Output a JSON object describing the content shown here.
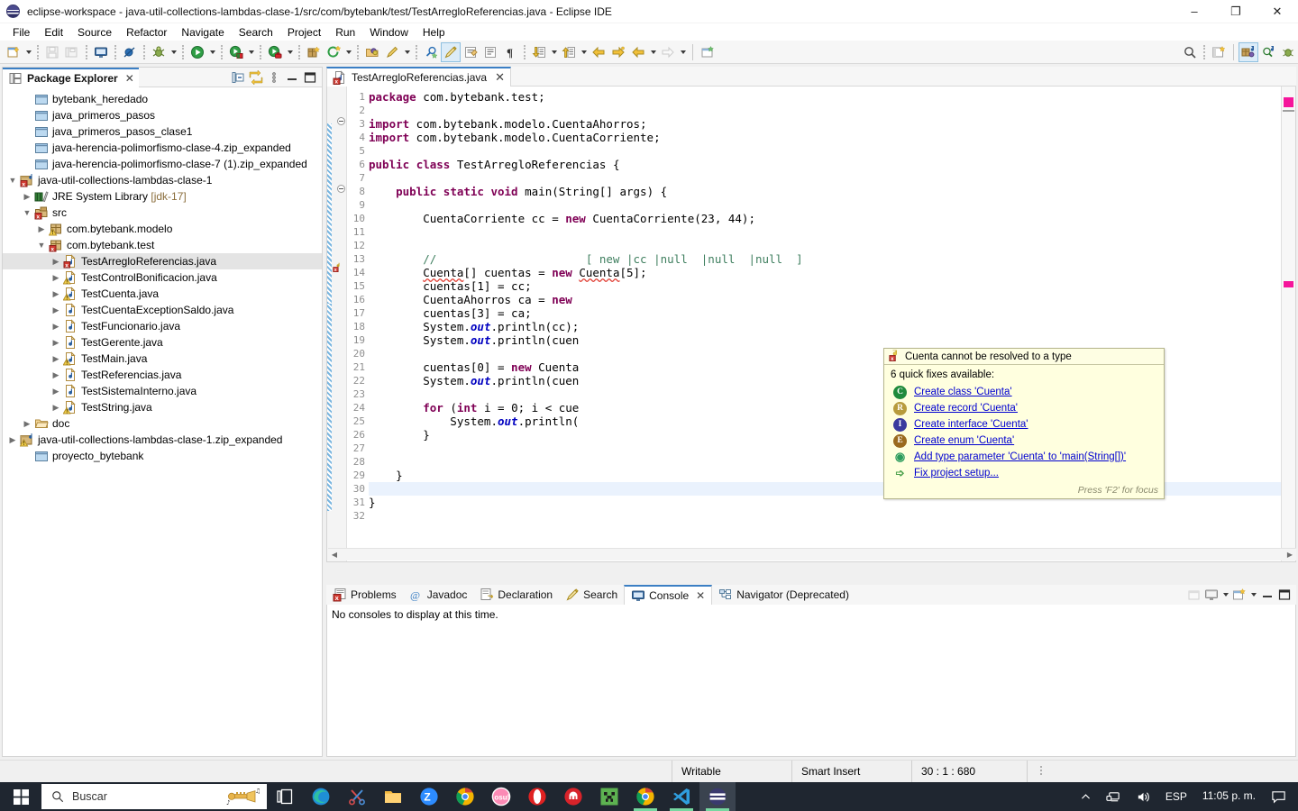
{
  "window": {
    "title": "eclipse-workspace - java-util-collections-lambdas-clase-1/src/com/bytebank/test/TestArregloReferencias.java - Eclipse IDE",
    "minimize": "–",
    "maximize": "❐",
    "close": "✕"
  },
  "menu": [
    "File",
    "Edit",
    "Source",
    "Refactor",
    "Navigate",
    "Search",
    "Project",
    "Run",
    "Window",
    "Help"
  ],
  "package_explorer": {
    "tab_label": "Package Explorer",
    "close": "✕",
    "tree": [
      {
        "label": "bytebank_heredado",
        "indent": 1,
        "twist": "",
        "icon": "project-closed-icon"
      },
      {
        "label": "java_primeros_pasos",
        "indent": 1,
        "twist": "",
        "icon": "project-closed-icon"
      },
      {
        "label": "java_primeros_pasos_clase1",
        "indent": 1,
        "twist": "",
        "icon": "project-closed-icon"
      },
      {
        "label": "java-herencia-polimorfismo-clase-4.zip_expanded",
        "indent": 1,
        "twist": "",
        "icon": "project-closed-icon"
      },
      {
        "label": "java-herencia-polimorfismo-clase-7 (1).zip_expanded",
        "indent": 1,
        "twist": "",
        "icon": "project-closed-icon"
      },
      {
        "label": "java-util-collections-lambdas-clase-1",
        "indent": 0,
        "twist": "open",
        "icon": "java-project-error-icon"
      },
      {
        "label": "JRE System Library",
        "suffix": " [jdk-17]",
        "indent": 1,
        "twist": "closed",
        "icon": "library-icon"
      },
      {
        "label": "src",
        "indent": 1,
        "twist": "open",
        "icon": "source-folder-error-icon"
      },
      {
        "label": "com.bytebank.modelo",
        "indent": 2,
        "twist": "closed",
        "icon": "package-warning-icon"
      },
      {
        "label": "com.bytebank.test",
        "indent": 2,
        "twist": "open",
        "icon": "package-error-icon"
      },
      {
        "label": "TestArregloReferencias.java",
        "indent": 3,
        "twist": "closed",
        "icon": "java-file-error-icon",
        "selected": true
      },
      {
        "label": "TestControlBonificacion.java",
        "indent": 3,
        "twist": "closed",
        "icon": "java-file-warning-icon"
      },
      {
        "label": "TestCuenta.java",
        "indent": 3,
        "twist": "closed",
        "icon": "java-file-warning-icon"
      },
      {
        "label": "TestCuentaExceptionSaldo.java",
        "indent": 3,
        "twist": "closed",
        "icon": "java-file-icon"
      },
      {
        "label": "TestFuncionario.java",
        "indent": 3,
        "twist": "closed",
        "icon": "java-file-icon"
      },
      {
        "label": "TestGerente.java",
        "indent": 3,
        "twist": "closed",
        "icon": "java-file-icon"
      },
      {
        "label": "TestMain.java",
        "indent": 3,
        "twist": "closed",
        "icon": "java-file-warning-icon"
      },
      {
        "label": "TestReferencias.java",
        "indent": 3,
        "twist": "closed",
        "icon": "java-file-icon"
      },
      {
        "label": "TestSistemaInterno.java",
        "indent": 3,
        "twist": "closed",
        "icon": "java-file-icon"
      },
      {
        "label": "TestString.java",
        "indent": 3,
        "twist": "closed",
        "icon": "java-file-warning-icon"
      },
      {
        "label": "doc",
        "indent": 1,
        "twist": "closed",
        "icon": "folder-icon"
      },
      {
        "label": "java-util-collections-lambdas-clase-1.zip_expanded",
        "indent": 0,
        "twist": "closed",
        "icon": "java-project-warning-icon"
      },
      {
        "label": "proyecto_bytebank",
        "indent": 1,
        "twist": "",
        "icon": "project-closed-icon"
      }
    ]
  },
  "editor": {
    "tab_label": "TestArregloReferencias.java",
    "close": "✕",
    "line_numbers": [
      1,
      2,
      3,
      4,
      5,
      6,
      7,
      8,
      9,
      10,
      11,
      12,
      13,
      14,
      15,
      16,
      17,
      18,
      19,
      20,
      21,
      22,
      23,
      24,
      25,
      26,
      27,
      28,
      29,
      30,
      31,
      32
    ],
    "highlight_line": 30,
    "lines": [
      {
        "n": 1,
        "html": "<span class=\"kw\">package</span> com.bytebank.test;"
      },
      {
        "n": 2,
        "html": ""
      },
      {
        "n": 3,
        "html": "<span class=\"kw\">import</span> com.bytebank.modelo.CuentaAhorros;",
        "fold": true
      },
      {
        "n": 4,
        "html": "<span class=\"kw\">import</span> com.bytebank.modelo.CuentaCorriente;"
      },
      {
        "n": 5,
        "html": ""
      },
      {
        "n": 6,
        "html": "<span class=\"kw\">public</span> <span class=\"kw\">class</span> TestArregloReferencias {"
      },
      {
        "n": 7,
        "html": ""
      },
      {
        "n": 8,
        "html": "    <span class=\"kw\">public</span> <span class=\"kw\">static</span> <span class=\"kw\">void</span> main(String[] args) {",
        "fold": true
      },
      {
        "n": 9,
        "html": ""
      },
      {
        "n": 10,
        "html": "        CuentaCorriente cc = <span class=\"kw\">new</span> CuentaCorriente(23, 44);"
      },
      {
        "n": 11,
        "html": ""
      },
      {
        "n": 12,
        "html": ""
      },
      {
        "n": 13,
        "html": "        <span class=\"cm\">//                      [ new |cc |null  |null  |null  ]</span>"
      },
      {
        "n": 14,
        "html": "        <span class=\"err\">Cuenta</span>[] cuentas = <span class=\"kw\">new</span> <span class=\"err\">Cuenta</span>[5];",
        "marker": "error"
      },
      {
        "n": 15,
        "html": "        cuentas[1] = cc;"
      },
      {
        "n": 16,
        "html": "        CuentaAhorros ca = <span class=\"kw\">new</span>"
      },
      {
        "n": 17,
        "html": "        cuentas[3] = ca;"
      },
      {
        "n": 18,
        "html": "        System.<span class=\"fld\">out</span>.println(cc);"
      },
      {
        "n": 19,
        "html": "        System.<span class=\"fld\">out</span>.println(cuen"
      },
      {
        "n": 20,
        "html": ""
      },
      {
        "n": 21,
        "html": "        cuentas[0] = <span class=\"kw\">new</span> Cuenta"
      },
      {
        "n": 22,
        "html": "        System.<span class=\"fld\">out</span>.println(cuen"
      },
      {
        "n": 23,
        "html": ""
      },
      {
        "n": 24,
        "html": "        <span class=\"kw\">for</span> (<span class=\"kw\">int</span> i = 0; i &lt; cue"
      },
      {
        "n": 25,
        "html": "            System.<span class=\"fld\">out</span>.println("
      },
      {
        "n": 26,
        "html": "        }"
      },
      {
        "n": 27,
        "html": ""
      },
      {
        "n": 28,
        "html": ""
      },
      {
        "n": 29,
        "html": "    }"
      },
      {
        "n": 30,
        "html": ""
      },
      {
        "n": 31,
        "html": "}"
      },
      {
        "n": 32,
        "html": ""
      }
    ]
  },
  "quickfix": {
    "title": "Cuenta cannot be resolved to a type",
    "count_label": "6 quick fixes available:",
    "items": [
      {
        "label": "Create class 'Cuenta'",
        "badge": "C",
        "color": "#1f8a3b"
      },
      {
        "label": "Create record 'Cuenta'",
        "badge": "R",
        "color": "#b79b3c"
      },
      {
        "label": "Create interface 'Cuenta'",
        "badge": "I",
        "color": "#3b3b9e"
      },
      {
        "label": "Create enum 'Cuenta'",
        "badge": "E",
        "color": "#9a6a1e"
      },
      {
        "label": "Add type parameter 'Cuenta' to 'main(String[])'",
        "badge": "○",
        "color": "#2b9b5c"
      },
      {
        "label": "Fix project setup...",
        "badge": "➤",
        "color": "#4aa04a"
      }
    ],
    "footer": "Press 'F2' for focus"
  },
  "bottom_panel": {
    "tabs": [
      {
        "label": "Problems",
        "icon": "problems-icon",
        "active": false
      },
      {
        "label": "Javadoc",
        "icon": "javadoc-icon",
        "active": false
      },
      {
        "label": "Declaration",
        "icon": "declaration-icon",
        "active": false
      },
      {
        "label": "Search",
        "icon": "search-tab-icon",
        "active": false
      },
      {
        "label": "Console",
        "icon": "console-icon",
        "active": true,
        "closable": true
      },
      {
        "label": "Navigator (Deprecated)",
        "icon": "navigator-icon",
        "active": false
      }
    ],
    "content": "No consoles to display at this time."
  },
  "statusbar": {
    "writable": "Writable",
    "insert_mode": "Smart Insert",
    "position": "30 : 1 : 680"
  },
  "taskbar": {
    "search_placeholder": "Buscar",
    "language": "ESP",
    "time": "11:05 p. m.",
    "apps": [
      {
        "name": "task-view-icon"
      },
      {
        "name": "edge-icon"
      },
      {
        "name": "snipping-tool-icon"
      },
      {
        "name": "file-explorer-icon"
      },
      {
        "name": "zoom-icon"
      },
      {
        "name": "chrome-icon"
      },
      {
        "name": "osu-icon"
      },
      {
        "name": "opera-icon"
      },
      {
        "name": "red-app-icon"
      },
      {
        "name": "minecraft-icon"
      },
      {
        "name": "chrome-2-icon"
      },
      {
        "name": "vscode-icon"
      },
      {
        "name": "eclipse-icon"
      }
    ]
  },
  "colors": {
    "accent": "#3b7fc4",
    "keyword": "#7f0055",
    "comment": "#3f7f5f",
    "field": "#0000c0",
    "error": "#e03c31",
    "tooltip_bg": "#ffffdf"
  }
}
